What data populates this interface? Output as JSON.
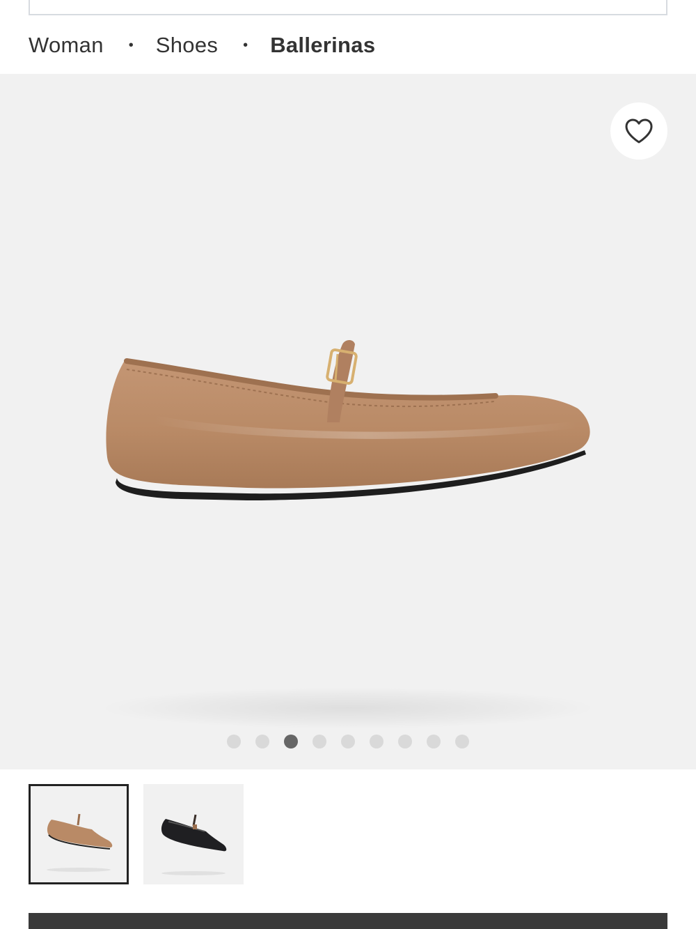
{
  "breadcrumb": {
    "items": [
      {
        "label": "Woman"
      },
      {
        "label": "Shoes"
      },
      {
        "label": "Ballerinas"
      }
    ],
    "separator": "•"
  },
  "gallery": {
    "favorite_icon": "heart-outline-icon",
    "dots_count": 9,
    "active_dot_index": 2,
    "product_color": "#b98a66"
  },
  "thumbnails": [
    {
      "color": "camel",
      "selected": true
    },
    {
      "color": "black",
      "selected": false
    }
  ],
  "colors": {
    "gallery_bg": "#f1f1f1",
    "dot_inactive": "#d9d9d9",
    "dot_active": "#666666",
    "bottom_bar": "#3a3a3a"
  }
}
